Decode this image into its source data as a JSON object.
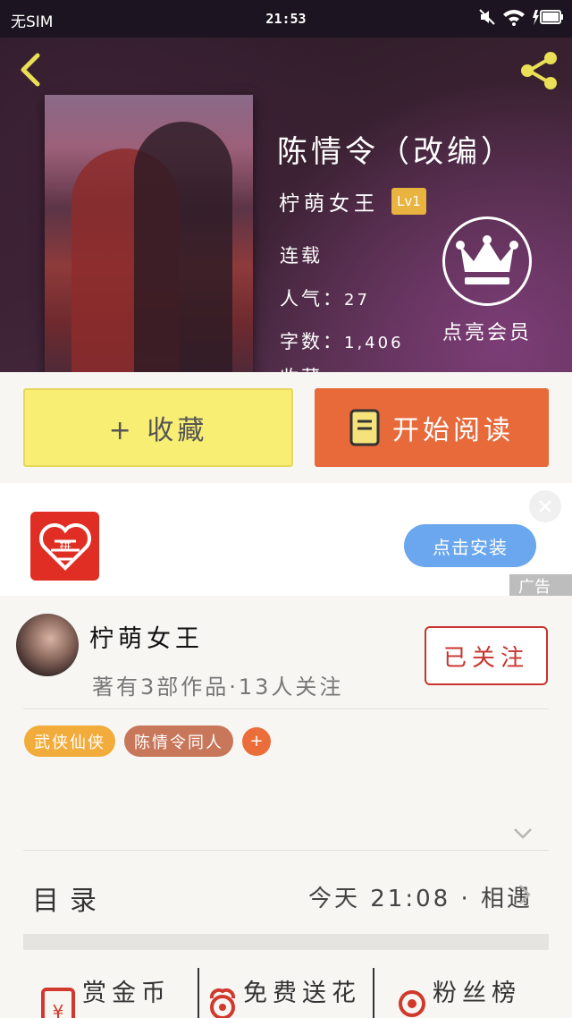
{
  "status_bar": {
    "carrier": "无SIM",
    "time": "21:53"
  },
  "book": {
    "title": "陈情令（改编）",
    "author": "柠萌女王",
    "level": "Lv1",
    "status": "连载",
    "popularity_label": "人气：",
    "popularity_value": "27",
    "word_count_label": "字数：",
    "word_count_value": "1,406",
    "more_cut": "收藏"
  },
  "vip": {
    "label": "点亮会员"
  },
  "actions": {
    "collect_label": "+ 收藏",
    "read_label": "开始阅读"
  },
  "ad": {
    "install_label": "点击安装",
    "tag_label": "广告",
    "logo_text": "拼"
  },
  "author_card": {
    "name": "柠萌女王",
    "stats": "著有3部作品·13人关注",
    "follow_label": "已关注",
    "tags": [
      "武侠仙侠",
      "陈情令同人"
    ],
    "add_tag": "+"
  },
  "toc": {
    "label": "目录",
    "latest": "今天 21:08 · 相遇"
  },
  "bottom_tabs": [
    {
      "label": "赏金币",
      "icon": "red-envelope-icon"
    },
    {
      "label": "免费送花",
      "icon": "flower-icon"
    },
    {
      "label": "粉丝榜",
      "icon": "medal-icon"
    }
  ],
  "colors": {
    "accent_orange": "#e86a3a",
    "collect_yellow": "#f9ee74",
    "follow_red": "#c8342e",
    "install_blue": "#6aa7ef",
    "level_gold": "#e9b33f"
  }
}
